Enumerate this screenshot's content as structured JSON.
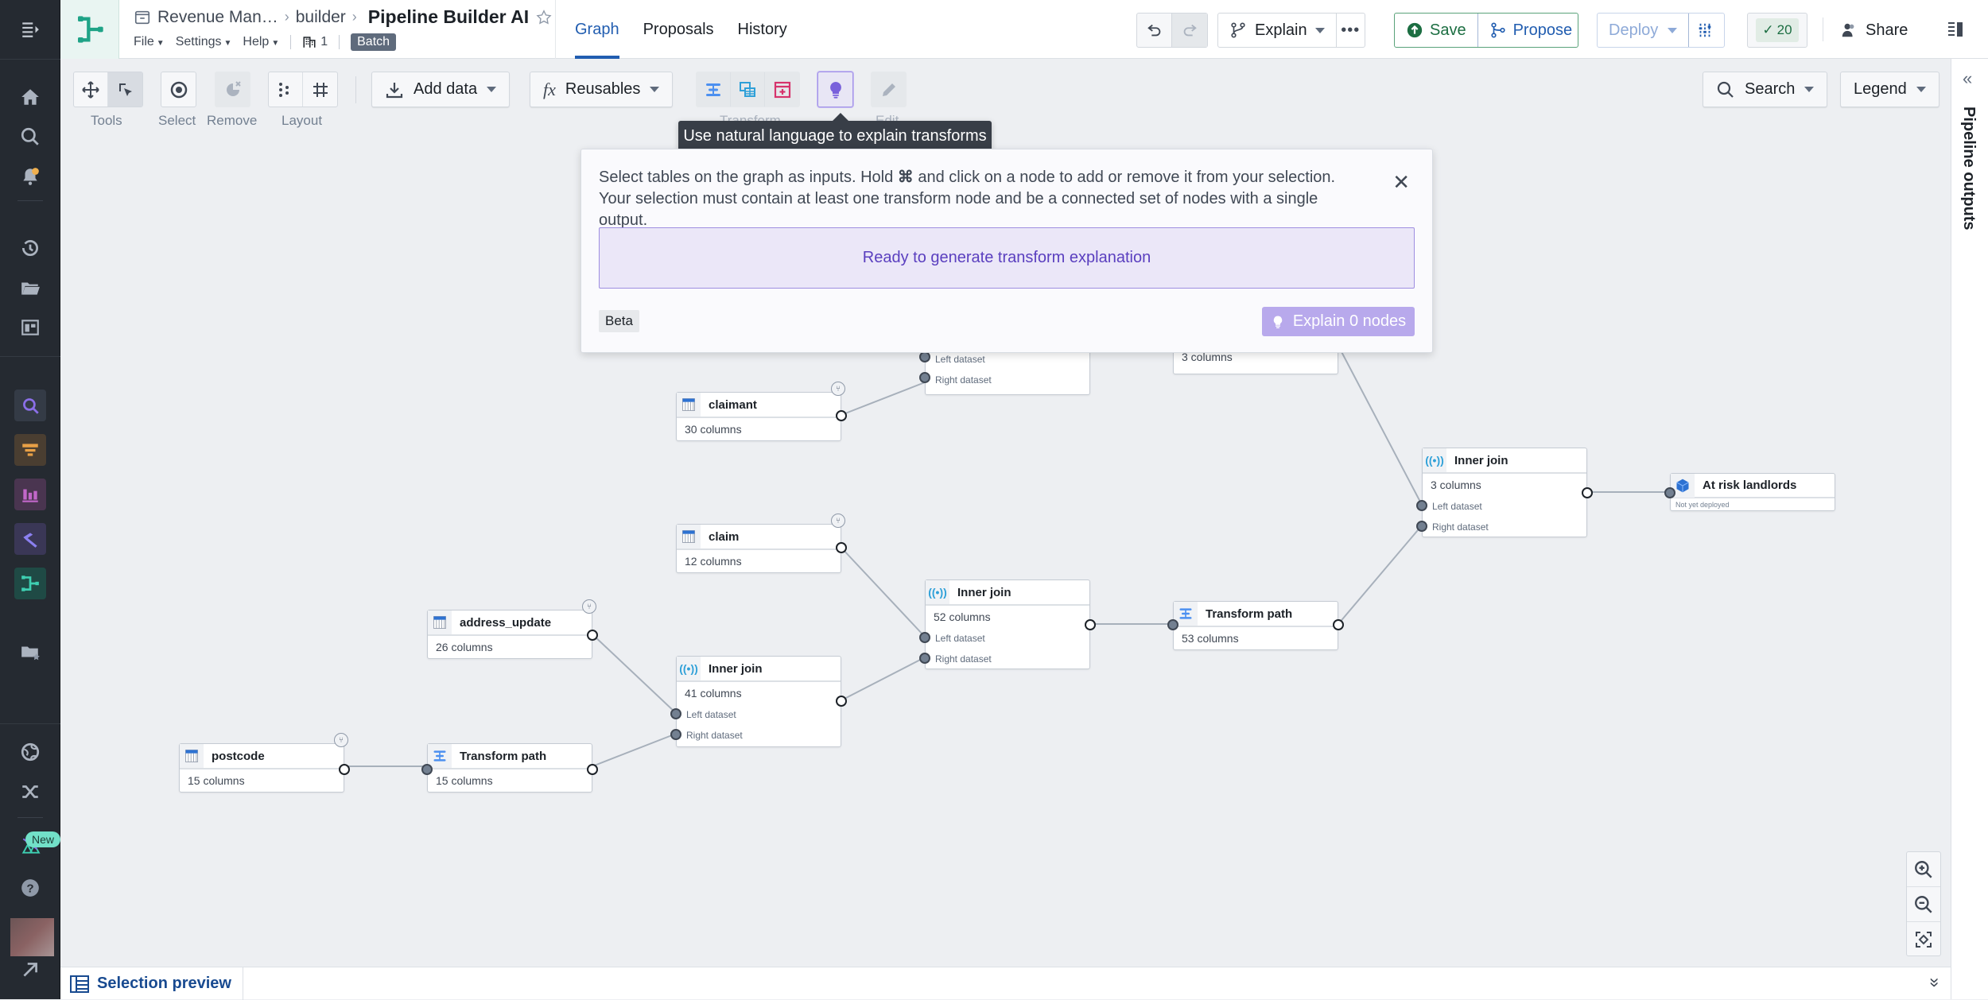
{
  "header": {
    "breadcrumb": [
      "Revenue Man…",
      "builder"
    ],
    "title": "Pipeline Builder AI",
    "menus": [
      "File",
      "Settings",
      "Help"
    ],
    "branch_count": "1",
    "mode_badge": "Batch",
    "tabs": [
      {
        "label": "Graph",
        "active": true
      },
      {
        "label": "Proposals",
        "active": false
      },
      {
        "label": "History",
        "active": false
      }
    ],
    "explain_label": "Explain",
    "save_label": "Save",
    "propose_label": "Propose",
    "deploy_label": "Deploy",
    "checks_count": "20",
    "share_label": "Share"
  },
  "toolbar": {
    "groups": [
      {
        "label": "Tools"
      },
      {
        "label": "Select"
      },
      {
        "label": "Remove"
      },
      {
        "label": "Layout"
      },
      {
        "label": "Transform"
      },
      {
        "label": "Edit"
      }
    ],
    "add_data_label": "Add data",
    "reusables_label": "Reusables",
    "search_label": "Search",
    "legend_label": "Legend"
  },
  "tooltip": "Use natural language to explain transforms",
  "explain_panel": {
    "description_part1": "Select tables on the graph as inputs. Hold",
    "description_key": "⌘",
    "description_part2": "and click on a node to add or remove it from your selection. Your selection must contain at least one transform node and be a connected set of nodes with a single output.",
    "status": "Ready to generate transform explanation",
    "beta_label": "Beta",
    "explain_button": "Explain 0 nodes"
  },
  "graph": {
    "nodes": [
      {
        "id": "postcode",
        "type": "dataset",
        "title": "postcode",
        "columns": "15 columns"
      },
      {
        "id": "transform15",
        "type": "transform",
        "title": "Transform path",
        "columns": "15 columns"
      },
      {
        "id": "address_update",
        "type": "dataset",
        "title": "address_update",
        "columns": "26 columns"
      },
      {
        "id": "join41",
        "type": "join",
        "title": "Inner join",
        "columns": "41 columns",
        "ports": [
          "Left dataset",
          "Right dataset"
        ]
      },
      {
        "id": "claim",
        "type": "dataset",
        "title": "claim",
        "columns": "12 columns"
      },
      {
        "id": "claimant",
        "type": "dataset",
        "title": "claimant",
        "columns": "30 columns"
      },
      {
        "id": "join52",
        "type": "join",
        "title": "Inner join",
        "columns": "52 columns",
        "ports": [
          "Left dataset",
          "Right dataset"
        ]
      },
      {
        "id": "transform53",
        "type": "transform",
        "title": "Transform path",
        "columns": "53 columns"
      },
      {
        "id": "join3",
        "type": "join",
        "title": "Inner join",
        "columns": "3 columns",
        "ports": [
          "Left dataset",
          "Right dataset"
        ]
      },
      {
        "id": "output",
        "type": "output",
        "title": "At risk landlords",
        "status": "Not yet deployed"
      },
      {
        "id": "joinTop",
        "type": "join",
        "title": "",
        "columns": "",
        "ports": [
          "Left dataset",
          "Right dataset"
        ]
      },
      {
        "id": "transformTop",
        "type": "transform",
        "title": "",
        "columns": "3 columns"
      }
    ]
  },
  "right_panel": {
    "label": "Pipeline outputs"
  },
  "bottom_bar": {
    "selection_preview": "Selection preview"
  },
  "sidebar": {
    "new_badge": "New"
  },
  "colors": {
    "accent": "#215db0",
    "save_green": "#1c6e42",
    "explain_purple": "#7961db",
    "dataset_blue": "#2d72d2",
    "transform_blue": "#4c90f0"
  }
}
